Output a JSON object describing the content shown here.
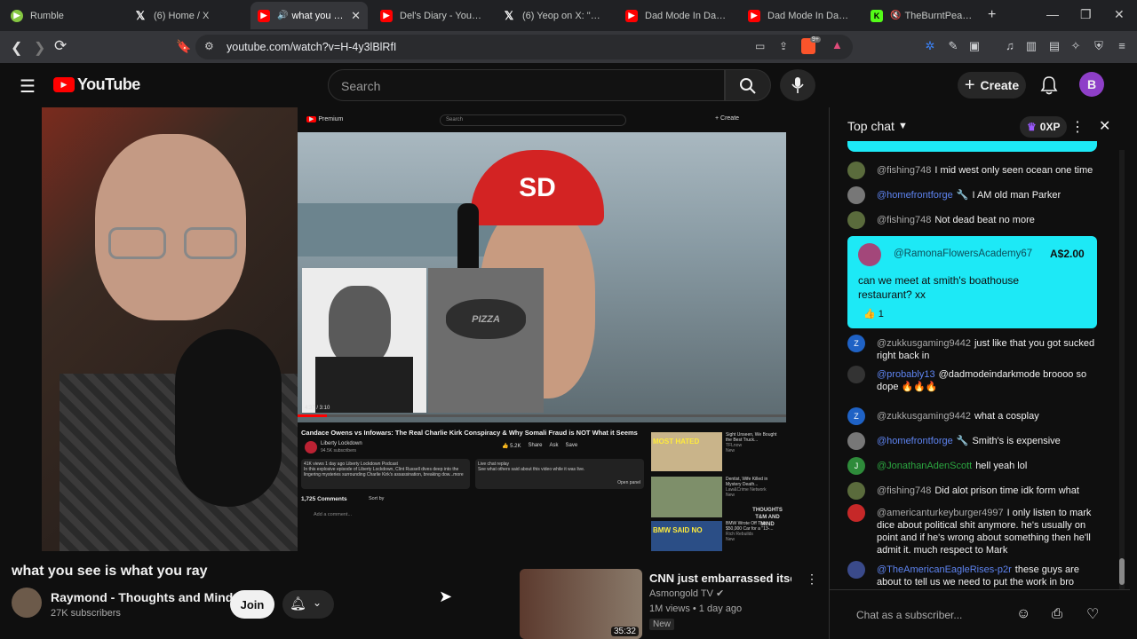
{
  "browser": {
    "tabs": [
      {
        "title": "Rumble",
        "icon": "rumble-icon",
        "color": "#85c742"
      },
      {
        "title": "(6) Home / X",
        "icon": "x-icon",
        "color": "#ffffff"
      },
      {
        "title": "what you see i",
        "icon": "youtube-icon",
        "color": "#ff0000",
        "active": true
      },
      {
        "title": "Del's Diary - YouTube",
        "icon": "youtube-icon",
        "color": "#ff0000"
      },
      {
        "title": "(6) Yeop on X: \"@Fore",
        "icon": "x-icon",
        "color": "#ffffff"
      },
      {
        "title": "Dad Mode In Dark Mo",
        "icon": "youtube-icon",
        "color": "#ff0000"
      },
      {
        "title": "Dad Mode In Dark Mo",
        "icon": "youtube-icon",
        "color": "#ff0000"
      },
      {
        "title": "TheBurntPeanut S",
        "icon": "kick-icon",
        "color": "#53fc18"
      }
    ],
    "url": "youtube.com/watch?v=H-4y3lBlRfI",
    "new_tab": "+",
    "brave_badge": "9+"
  },
  "youtube": {
    "logo_text": "YouTube",
    "search_placeholder": "Search",
    "create_label": "Create",
    "avatar_letter": "B"
  },
  "video_overlay": {
    "inner_title": "Candace Owens vs Infowars: The Real Charlie Kirk Conspiracy & Why Somali Fraud is NOT What it Seems",
    "inner_channel": "Liberty Lockdown",
    "inner_subs": "94.5K subscribers",
    "inner_meta": "41K views  1 day ago  Liberty Lockdown Podcast",
    "inner_desc": "In this explosive episode of Liberty Lockdown, Clint Russell dives deep into the lingering mysteries surrounding Charlie Kirk's assassination, breaking dow...more",
    "inner_likes": "5.2K",
    "inner_share": "Share",
    "inner_ask": "Ask",
    "inner_save": "Save",
    "inner_comments": "1,725 Comments",
    "inner_sort": "Sort by",
    "inner_add_comment": "Add a comment...",
    "inner_chat_replay": "Live chat replay",
    "inner_chat_replay_sub": "See what others said about this video while it was live.",
    "inner_open_panel": "Open panel",
    "inner_search": "Search",
    "inner_create": "+ Create",
    "inner_premium": "Premium",
    "inner_time": "4:37 / 3:10",
    "lips_text": "PIZZA",
    "cap_text": "SD",
    "watermark": "THOUGHTS T&M AND MIND",
    "side_videos": [
      {
        "thumb_text": "MOST HATED",
        "title": "Sight Unseen, We Bought the Best Truck...",
        "channel": "TFLnow",
        "meta": "New"
      },
      {
        "thumb_text": "",
        "title": "Dentist, Wife Killed in Mystery Death...",
        "channel": "Law&Crime Network",
        "meta": "New"
      },
      {
        "thumb_text": "BMW SAID NO",
        "title": "BMW Wrote Off This $50,000 Car for a \"13-...",
        "channel": "Rich Rebuilds",
        "meta": "New"
      }
    ]
  },
  "video": {
    "title": "what you see is what you ray",
    "channel": "Raymond - Thoughts and Mind",
    "subscribers": "27K subscribers",
    "join_label": "Join"
  },
  "recommended": {
    "title": "CNN just embarrassed itself..",
    "channel": "Asmongold TV",
    "meta": "1M views • 1 day ago",
    "badge": "New",
    "duration": "35:32"
  },
  "chat": {
    "header": "Top chat",
    "xp": "0XP",
    "messages": [
      {
        "author": "@fishing748",
        "text": "I mid west only seen ocean one time",
        "mod": false,
        "avatar_color": "#5a6b3c"
      },
      {
        "author": "@homefrontforge",
        "text": "I AM old man Parker",
        "mod": true,
        "avatar_color": "#777777"
      },
      {
        "author": "@fishing748",
        "text": "Not dead beat no more",
        "mod": false,
        "avatar_color": "#5a6b3c"
      },
      {
        "author": "@zukkusgaming9442",
        "text": "just like that you got sucked right back in",
        "mod": false,
        "avatar_color": "#1f62c5",
        "avatar_letter": "Z"
      },
      {
        "author": "@probably13",
        "text": "@dadmodeindarkmode broooo so dope 🔥🔥🔥",
        "mod": true,
        "avatar_color": "#333333"
      },
      {
        "author": "@zukkusgaming9442",
        "text": "what a cosplay",
        "mod": false,
        "avatar_color": "#1f62c5",
        "avatar_letter": "Z"
      },
      {
        "author": "@homefrontforge",
        "text": "Smith's is expensive",
        "mod": true,
        "avatar_color": "#777777"
      },
      {
        "author": "@JonathanAdenScott",
        "text": "hell yeah lol",
        "mod": true,
        "avatar_color": "#2e8b3a",
        "avatar_letter": "J"
      },
      {
        "author": "@fishing748",
        "text": "Did alot prison time idk form what",
        "mod": false,
        "avatar_color": "#5a6b3c"
      },
      {
        "author": "@americanturkeyburger4997",
        "text": "I only listen to mark dice about political shit anymore. he's usually on point and if he's wrong about something then he'll admit it. much respect to Mark",
        "mod": false,
        "avatar_color": "#c62828"
      },
      {
        "author": "@TheAmericanEagleRises-p2r",
        "text": "these guys are about to tell us we need to put the work in bro",
        "mod": true,
        "avatar_color": "#3a4a8a"
      }
    ],
    "superchat": {
      "author": "@RamonaFlowersAcademy67",
      "amount": "A$2.00",
      "text": "can we meet at smith's boathouse restaurant? xx",
      "likes": "1",
      "color": "#1de9f6"
    },
    "input_placeholder": "Chat as a subscriber..."
  }
}
